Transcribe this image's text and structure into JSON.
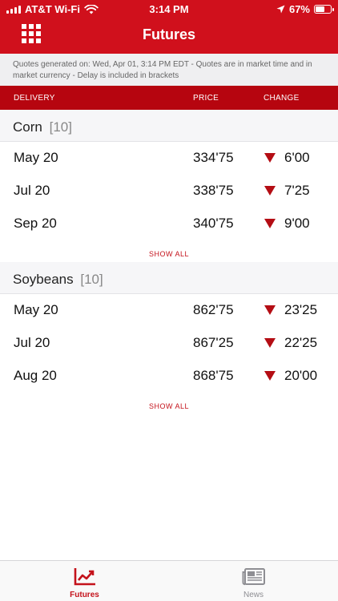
{
  "status_bar": {
    "carrier": "AT&T Wi-Fi",
    "time": "3:14 PM",
    "battery": "67%",
    "battery_level": 0.67
  },
  "header": {
    "title": "Futures",
    "menu_icon": "grid-menu-icon",
    "background": "#d0101c"
  },
  "note": {
    "text": "Quotes generated on: Wed, Apr 01, 3:14 PM EDT - Quotes are in market time and in market currency - Delay is included in brackets"
  },
  "columns": {
    "delivery": "DELIVERY",
    "price": "PRICE",
    "change": "CHANGE"
  },
  "sections": [
    {
      "name": "Corn",
      "count": "[10]",
      "rows": [
        {
          "delivery": "May 20",
          "price": "334'75",
          "change": "6'00",
          "direction": "down"
        },
        {
          "delivery": "Jul 20",
          "price": "338'75",
          "change": "7'25",
          "direction": "down"
        },
        {
          "delivery": "Sep 20",
          "price": "340'75",
          "change": "9'00",
          "direction": "down"
        }
      ],
      "show_all": "SHOW ALL"
    },
    {
      "name": "Soybeans",
      "count": "[10]",
      "rows": [
        {
          "delivery": "May 20",
          "price": "862'75",
          "change": "23'25",
          "direction": "down"
        },
        {
          "delivery": "Jul 20",
          "price": "867'25",
          "change": "22'25",
          "direction": "down"
        },
        {
          "delivery": "Aug 20",
          "price": "868'75",
          "change": "20'00",
          "direction": "down"
        }
      ],
      "show_all": "SHOW ALL"
    }
  ],
  "tabs": [
    {
      "label": "Futures",
      "icon": "chart-trend-icon",
      "active": true
    },
    {
      "label": "News",
      "icon": "newspaper-icon",
      "active": false
    }
  ],
  "colors": {
    "accent": "#c4121b",
    "down_arrow": "#b40d14",
    "column_header": "#b6050f"
  }
}
